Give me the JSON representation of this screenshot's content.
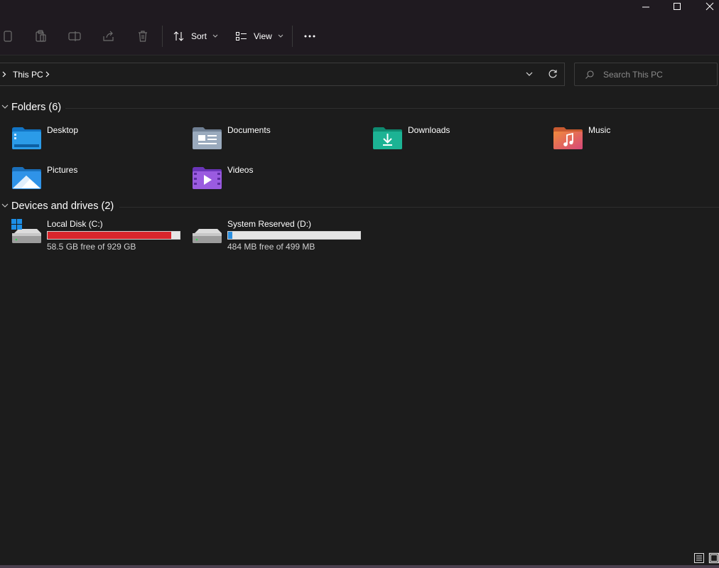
{
  "window": {
    "controls": [
      "minimize",
      "maximize",
      "close"
    ]
  },
  "toolbar": {
    "sort_label": "Sort",
    "view_label": "View",
    "icons": [
      "copy-icon",
      "paste-icon",
      "rename-icon",
      "share-icon",
      "delete-icon",
      "more-icon"
    ]
  },
  "address": {
    "current": "This PC"
  },
  "search": {
    "placeholder": "Search This PC"
  },
  "folders": {
    "title": "Folders (6)",
    "items": [
      {
        "label": "Desktop",
        "icon": "desktop-folder-icon",
        "color": "#1e90d6"
      },
      {
        "label": "Documents",
        "icon": "documents-folder-icon",
        "color": "#8a9bb0"
      },
      {
        "label": "Downloads",
        "icon": "downloads-folder-icon",
        "color": "#1aa88a"
      },
      {
        "label": "Music",
        "icon": "music-folder-icon",
        "color": "#e8734a"
      },
      {
        "label": "Pictures",
        "icon": "pictures-folder-icon",
        "color": "#2b8fe0"
      },
      {
        "label": "Videos",
        "icon": "videos-folder-icon",
        "color": "#8a4fd6"
      }
    ]
  },
  "drives": {
    "title": "Devices and drives (2)",
    "items": [
      {
        "label": "Local Disk (C:)",
        "free_text": "58.5 GB free of 929 GB",
        "used_fraction": 0.937,
        "bar_color": "#d9262c"
      },
      {
        "label": "System Reserved (D:)",
        "free_text": "484 MB free of 499 MB",
        "used_fraction": 0.03,
        "bar_color": "#2b8fe0"
      }
    ]
  },
  "colors": {
    "background": "#1c1c1c",
    "titlebar": "#1f1a20",
    "accent": "#2b8fe0"
  }
}
